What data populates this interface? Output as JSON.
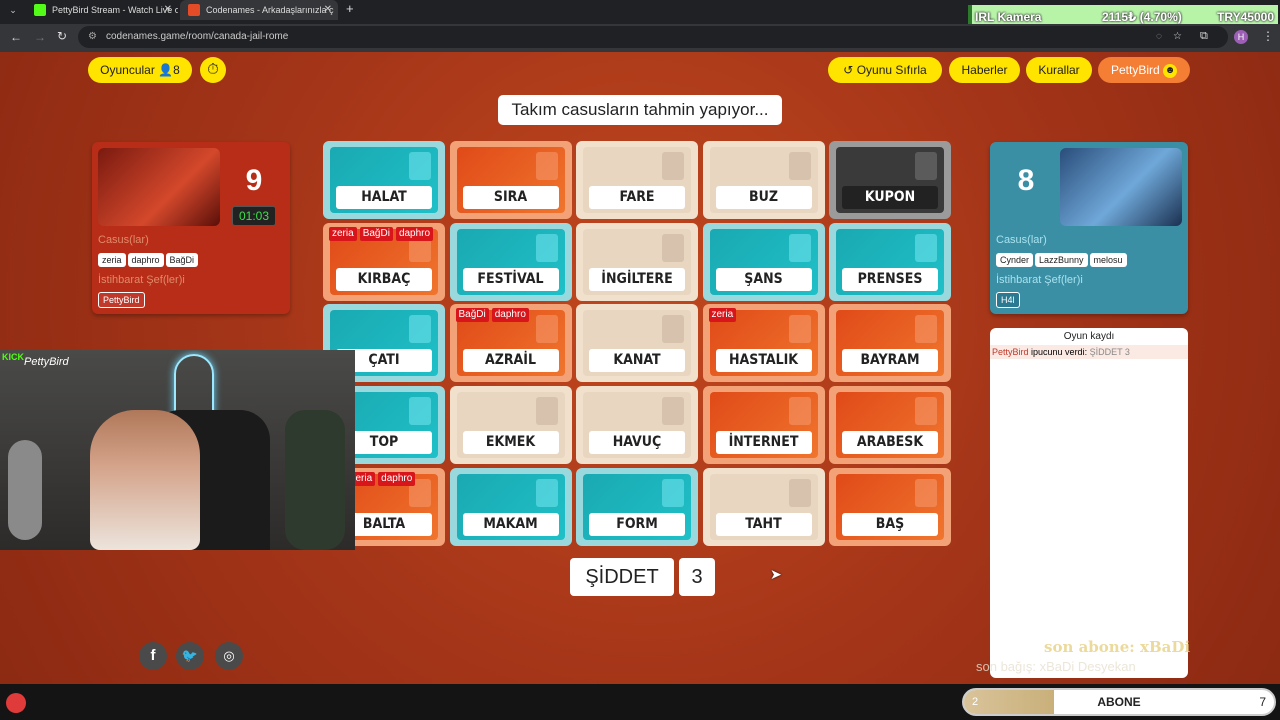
{
  "browser": {
    "tabs": [
      {
        "title": "PettyBird Stream - Watch Live o",
        "active": false
      },
      {
        "title": "Codenames - Arkadaşlarınızla ç",
        "active": true
      }
    ],
    "url": "codenames.game/room/canada-jail-rome",
    "profile_initial": "H"
  },
  "ticker": {
    "label": "IRL Kamera",
    "value": "2115₺ (4.70%)",
    "goal": "TRY45000"
  },
  "topbar": {
    "players_label": "Oyuncular",
    "players_count": "8",
    "reset_label": "Oyunu Sıfırla",
    "news_label": "Haberler",
    "rules_label": "Kurallar",
    "user_label": "PettyBird"
  },
  "status_banner": "Takım casusların tahmin yapıyor...",
  "red_team": {
    "score": "9",
    "timer": "01:03",
    "operatives_label": "Casus(lar)",
    "operatives": [
      "zeria",
      "daphro",
      "BağDi"
    ],
    "spymaster_label": "İstihbarat Şef(ler)i",
    "spymasters": [
      "PettyBird"
    ]
  },
  "blue_team": {
    "score": "8",
    "operatives_label": "Casus(lar)",
    "operatives": [
      "Cynder",
      "LazzBunny",
      "melosu"
    ],
    "spymaster_label": "İstihbarat Şef(ler)i",
    "spymasters": [
      "H4l"
    ]
  },
  "board": [
    {
      "word": "HALAT",
      "color": "blue",
      "tags": []
    },
    {
      "word": "SIRA",
      "color": "red",
      "tags": []
    },
    {
      "word": "FARE",
      "color": "neutral",
      "tags": []
    },
    {
      "word": "BUZ",
      "color": "neutral",
      "tags": []
    },
    {
      "word": "KUPON",
      "color": "black",
      "tags": []
    },
    {
      "word": "KIRBAÇ",
      "color": "red",
      "tags": [
        "zeria",
        "BağDi",
        "daphro"
      ]
    },
    {
      "word": "FESTİVAL",
      "color": "blue",
      "tags": []
    },
    {
      "word": "İNGİLTERE",
      "color": "neutral",
      "tags": []
    },
    {
      "word": "ŞANS",
      "color": "blue",
      "tags": []
    },
    {
      "word": "PRENSES",
      "color": "blue",
      "tags": []
    },
    {
      "word": "ÇATI",
      "color": "blue",
      "tags": []
    },
    {
      "word": "AZRAİL",
      "color": "red",
      "tags": [
        "BağDi",
        "daphro"
      ]
    },
    {
      "word": "KANAT",
      "color": "neutral",
      "tags": []
    },
    {
      "word": "HASTALIK",
      "color": "red",
      "tags": [
        "zeria"
      ]
    },
    {
      "word": "BAYRAM",
      "color": "red",
      "tags": []
    },
    {
      "word": "TOP",
      "color": "blue",
      "tags": []
    },
    {
      "word": "EKMEK",
      "color": "neutral",
      "tags": []
    },
    {
      "word": "HAVUÇ",
      "color": "neutral",
      "tags": []
    },
    {
      "word": "İNTERNET",
      "color": "red",
      "tags": []
    },
    {
      "word": "ARABESK",
      "color": "red",
      "tags": []
    },
    {
      "word": "BALTA",
      "color": "red",
      "tags": [
        "Di",
        "zeria",
        "daphro"
      ]
    },
    {
      "word": "MAKAM",
      "color": "blue",
      "tags": []
    },
    {
      "word": "FORM",
      "color": "blue",
      "tags": []
    },
    {
      "word": "TAHT",
      "color": "neutral",
      "tags": []
    },
    {
      "word": "BAŞ",
      "color": "red",
      "tags": []
    }
  ],
  "clue": {
    "word": "ŞİDDET",
    "number": "3"
  },
  "game_log": {
    "title": "Oyun kaydı",
    "entries": [
      {
        "player": "PettyBird",
        "text": "ipucunu verdi:",
        "clue": "ŞİDDET 3"
      }
    ]
  },
  "social_icons": [
    "facebook-icon",
    "twitter-icon",
    "instagram-icon"
  ],
  "overlay": {
    "kick_logo": "KICK",
    "kick_name": "PettyBird",
    "last_sub": "son abone: xBaDi",
    "last_donation": "son bağış: xBaDi  Desyekan",
    "sub_goal_label": "ABONE",
    "sub_current": "2",
    "sub_target": "7",
    "sub_progress": 0.29
  },
  "colors": {
    "red_card": "#e85a22",
    "blue_card": "#1fb6bf",
    "neutral_card": "#e8d6c0",
    "assassin_card": "#3a3a3a",
    "accent_yellow": "#ffe400",
    "board_bg": "#a8381a"
  }
}
